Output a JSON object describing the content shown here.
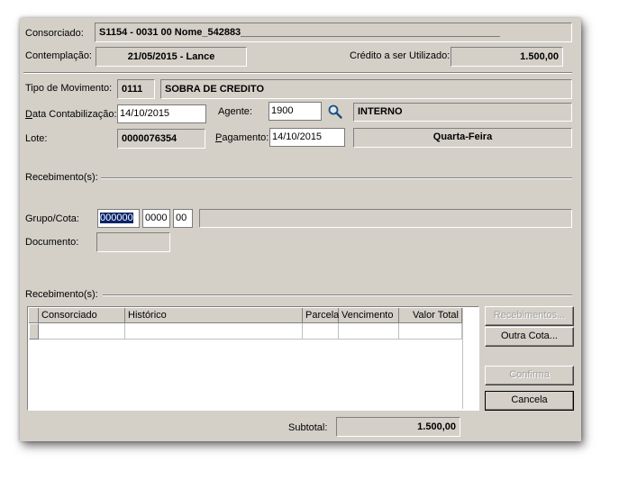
{
  "header": {
    "consorciado_label": "Consorciado:",
    "consorciado_value": "S1154 - 0031 00 Nome_542883_______________________________________________",
    "contemplacao_label": "Contemplação:",
    "contemplacao_value": "21/05/2015 - Lance",
    "credito_label": "Crédito a ser Utilizado:",
    "credito_value": "1.500,00"
  },
  "movimento": {
    "tipo_label": "Tipo de Movimento:",
    "tipo_code": "0111",
    "tipo_desc": "SOBRA DE CREDITO",
    "data_label": "Data Contabilização:",
    "data_value": "14/10/2015",
    "agente_label": "Agente:",
    "agente_value": "1900",
    "agente_nome": "INTERNO",
    "lote_label": "Lote:",
    "lote_value": "0000076354",
    "pagamento_label": "Pagamento:",
    "pagamento_value": "14/10/2015",
    "dia_semana": "Quarta-Feira"
  },
  "recebimento_top": {
    "section_label": "Recebimento(s):",
    "grupo_label": "Grupo/Cota:",
    "grupo_value": "000000",
    "cota_value": "0000",
    "digito_value": "00",
    "documento_label": "Documento:"
  },
  "recebimento_grid": {
    "section_label": "Recebimento(s):",
    "columns": [
      "Consorciado",
      "Histórico",
      "Parcela",
      "Vencimento",
      "Valor Total"
    ]
  },
  "buttons": {
    "recebimentos": "Recebimentos...",
    "outra_cota": "Outra Cota...",
    "confirma": "Confirma",
    "cancela": "Cancela"
  },
  "footer": {
    "subtotal_label": "Subtotal:",
    "subtotal_value": "1.500,00"
  },
  "icons": {
    "search": "magnifier-icon"
  }
}
